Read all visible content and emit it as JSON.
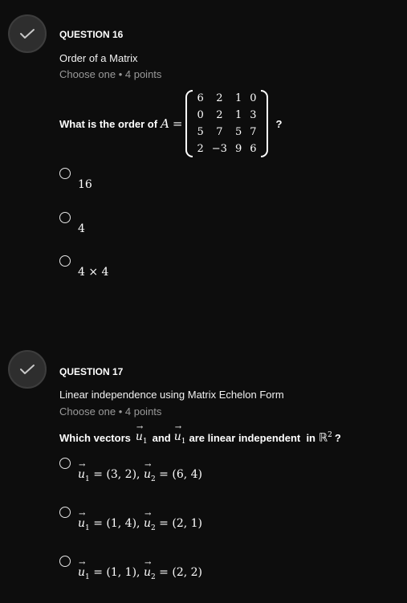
{
  "questions": [
    {
      "number_label": "QUESTION 16",
      "status_icon": "check-icon",
      "title": "Order of a Matrix",
      "meta": "Choose one • 4 points",
      "prompt_prefix": "What is the order of",
      "matrix_var": "A",
      "equals": "=",
      "prompt_suffix": "?",
      "matrix": [
        [
          "6",
          "2",
          "1",
          "0"
        ],
        [
          "0",
          "2",
          "1",
          "3"
        ],
        [
          "5",
          "7",
          "5",
          "7"
        ],
        [
          "2",
          "−3",
          "9",
          "6"
        ]
      ],
      "options": [
        {
          "label": "16",
          "selected": false
        },
        {
          "label": "4",
          "selected": false
        },
        {
          "label": "4 × 4",
          "selected": false
        }
      ]
    },
    {
      "number_label": "QUESTION 17",
      "status_icon": "check-icon",
      "title": "Linear independence using Matrix Echelon Form",
      "meta": "Choose one • 4 points",
      "prompt_part1": "Which vectors",
      "prompt_vec1": "u",
      "prompt_vec1_sub": "1",
      "prompt_part2": "and",
      "prompt_vec2": "u",
      "prompt_vec2_sub": "1",
      "prompt_part3": "are linear independent  in",
      "prompt_space": "ℝ",
      "prompt_space_exp": "2",
      "prompt_suffix": "?",
      "options": [
        {
          "u1": "= (3, 2),",
          "u2": "= (6, 4)",
          "selected": false
        },
        {
          "u1": "= (1, 4),",
          "u2": "= (2, 1)",
          "selected": false
        },
        {
          "u1": "= (1, 1),",
          "u2": "= (2, 2)",
          "selected": false
        }
      ],
      "vector_symbol": "u",
      "vector_sub_1": "1",
      "vector_sub_2": "2"
    }
  ],
  "colors": {
    "background": "#0d0d0d",
    "check_circle_bg": "#2e2e2e",
    "meta_text": "#9a9a9a",
    "text": "#ffffff"
  }
}
